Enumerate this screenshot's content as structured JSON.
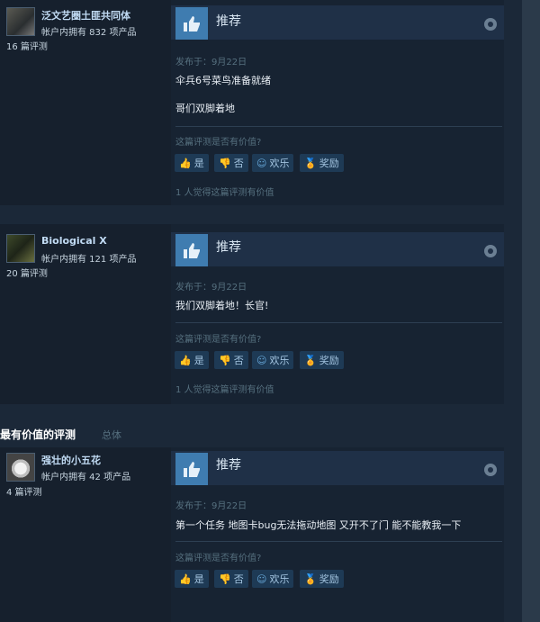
{
  "reviews": [
    {
      "username": "泛文艺圈土匪共同体",
      "owns": "帐户内拥有 832 项产品",
      "review_count": "16 篇评测",
      "title": "推荐",
      "posted": "发布于：9月22日",
      "lines": [
        "伞兵6号菜鸟准备就绪",
        "哥们双脚着地"
      ],
      "helpful_q": "这篇评测是否有价值?",
      "buttons": {
        "yes": "是",
        "no": "否",
        "funny": "欢乐",
        "award": "奖励"
      },
      "found_helpful": "1 人觉得这篇评测有价值"
    },
    {
      "username": "Biological X",
      "owns": "帐户内拥有 121 项产品",
      "review_count": "20 篇评测",
      "title": "推荐",
      "posted": "发布于：9月22日",
      "lines": [
        "我们双脚着地！长官!"
      ],
      "helpful_q": "这篇评测是否有价值?",
      "buttons": {
        "yes": "是",
        "no": "否",
        "funny": "欢乐",
        "award": "奖励"
      },
      "found_helpful": "1 人觉得这篇评测有价值"
    },
    {
      "username": "强壮的小五花",
      "owns": "帐户内拥有 42 项产品",
      "review_count": "4 篇评测",
      "title": "推荐",
      "posted": "发布于：9月22日",
      "lines": [
        "第一个任务 地图卡bug无法拖动地图 又开不了门 能不能教我一下"
      ],
      "helpful_q": "这篇评测是否有价值?",
      "buttons": {
        "yes": "是",
        "no": "否",
        "funny": "欢乐",
        "award": "奖励"
      }
    }
  ],
  "section": {
    "title": "最有价值的评测",
    "subtitle": "总体"
  },
  "icons": {
    "thumb": "thumbs-up-icon",
    "steam": "steam-logo-icon",
    "yes": "thumbs-up-small-icon",
    "no": "thumbs-down-small-icon",
    "funny": "smiley-icon",
    "award": "award-icon"
  },
  "colors": {
    "accent": "#3f7cb0",
    "background": "#1b2838",
    "link": "#c1dbf4"
  }
}
